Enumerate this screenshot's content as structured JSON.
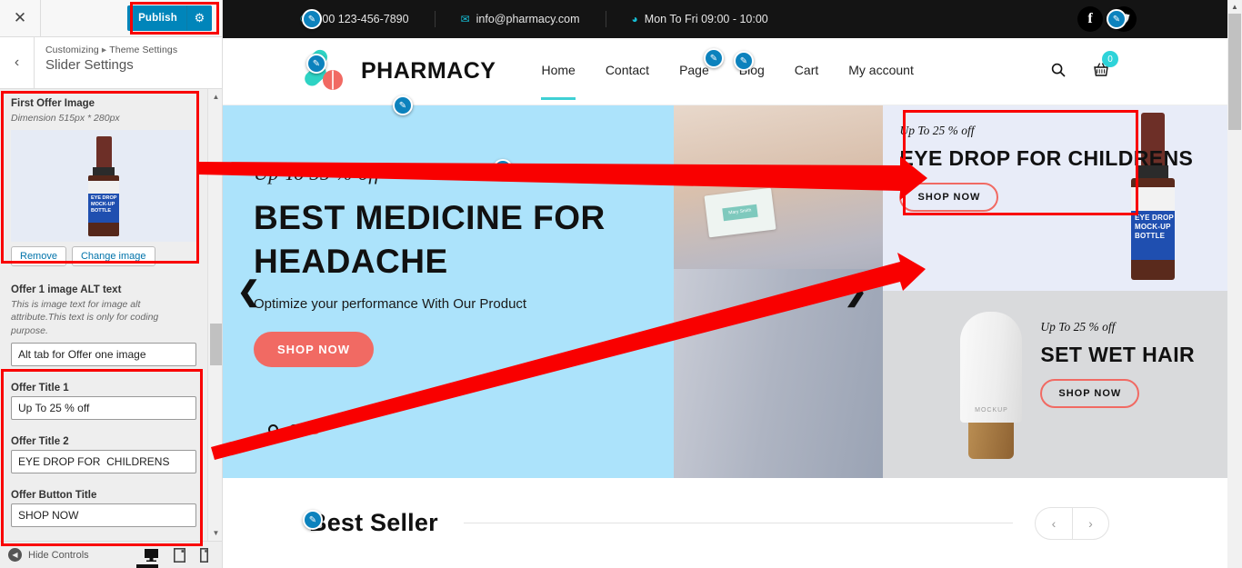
{
  "customizer": {
    "close_label": "✕",
    "publish_label": "Publish",
    "gear_icon": "⚙",
    "back_icon": "‹",
    "breadcrumb_root": "Customizing",
    "breadcrumb_sep": "▸",
    "breadcrumb_section": "Theme Settings",
    "panel_title": "Slider Settings",
    "fields": {
      "first_offer_image": {
        "label": "First Offer Image",
        "description": "Dimension 515px * 280px",
        "remove_label": "Remove",
        "change_label": "Change image",
        "image_label_line1": "EYE DROP",
        "image_label_line2": "MOCK-UP",
        "image_label_line3": "BOTTLE"
      },
      "alt_text": {
        "label": "Offer 1 image ALT text",
        "description": "This is image text for image alt attribute.This text is only for coding purpose.",
        "value": "Alt tab for Offer one image"
      },
      "offer_title_1": {
        "label": "Offer Title 1",
        "value": "Up To 25 % off"
      },
      "offer_title_2": {
        "label": "Offer Title 2",
        "value": "EYE DROP FOR  CHILDRENS"
      },
      "offer_button_title": {
        "label": "Offer Button Title",
        "value": "SHOP NOW"
      }
    },
    "footer": {
      "hide_controls_label": "Hide Controls",
      "hide_controls_icon": "◀",
      "device_desktop": "desktop-icon",
      "device_tablet": "tablet-icon",
      "device_mobile": "mobile-icon"
    },
    "scroll_up_icon": "▲",
    "scroll_down_icon": "▼"
  },
  "site": {
    "topbar": {
      "phone_icon": "✆",
      "phone": "+00 123-456-7890",
      "email_icon": "✉",
      "email": "info@pharmacy.com",
      "clock_icon": "◕",
      "hours": "Mon To Fri 09:00 - 10:00",
      "social": [
        {
          "name": "facebook-icon",
          "glyph": "f"
        },
        {
          "name": "twitter-icon",
          "glyph": "🐦"
        }
      ]
    },
    "header": {
      "logo_text": "PHARMACY",
      "nav": [
        {
          "label": "Home",
          "active": true
        },
        {
          "label": "Contact",
          "active": false
        },
        {
          "label": "Page",
          "active": false
        },
        {
          "label": "Blog",
          "active": false
        },
        {
          "label": "Cart",
          "active": false
        },
        {
          "label": "My account",
          "active": false
        }
      ],
      "search_icon": "search-icon",
      "cart_icon": "cart-icon",
      "cart_count": "0"
    },
    "hero": {
      "kicker": "Up To 35 % off",
      "title": "BEST MEDICINE FOR HEADACHE",
      "subtitle": "Optimize your performance With Our Product",
      "button": "SHOP NOW",
      "prev_icon": "❮",
      "next_icon": "❯",
      "dots": [
        {
          "active": false
        },
        {
          "active": false
        },
        {
          "active": true
        }
      ],
      "card_name": "Mary Smith"
    },
    "offer1": {
      "kicker": "Up To 25 % off",
      "title": "EYE DROP FOR CHILDRENS",
      "button": "SHOP NOW",
      "bottle_l1": "EYE DROP",
      "bottle_l2": "MOCK-UP",
      "bottle_l3": "BOTTLE"
    },
    "offer2": {
      "kicker": "Up To 25 % off",
      "title": "SET WET HAIR",
      "button": "SHOP NOW",
      "tube_text": "MOCKUP"
    },
    "bestseller": {
      "title": "Best Seller",
      "prev_icon": "‹",
      "next_icon": "›"
    }
  },
  "colors": {
    "publish_blue": "#0085ba",
    "highlight_red": "#f90000",
    "hero_bg": "#ace3fb",
    "offer1_bg": "#e8ecf8",
    "offer2_bg": "#d9dadc",
    "accent_teal": "#2ed3d9",
    "accent_coral": "#f16a63",
    "topbar_bg": "#141414"
  }
}
